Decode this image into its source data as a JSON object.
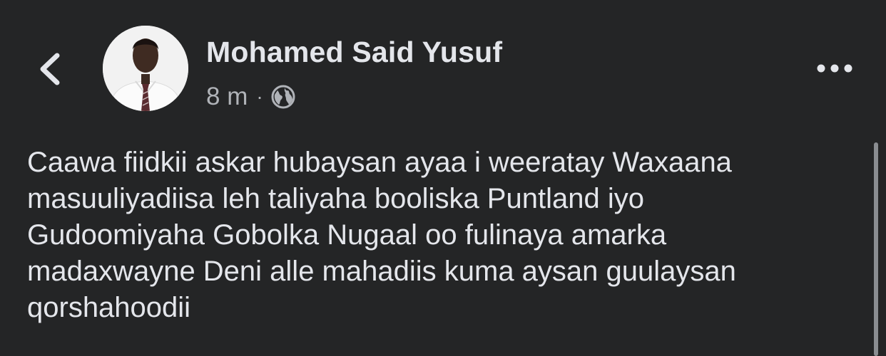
{
  "header": {
    "back_icon": "chevron-left-icon",
    "author_name": "Mohamed Said Yusuf",
    "timestamp": "8 m",
    "separator": "·",
    "privacy_icon": "globe-icon",
    "more_icon": "more-horizontal-icon"
  },
  "post": {
    "text": "Caawa fiidkii askar hubaysan ayaa i weeratay Waxaana\nmasuuliyadiisa  leh taliyaha booliska Puntland iyo\nGudoomiyaha Gobolka Nugaal oo fulinaya amarka\nmadaxwayne Deni alle mahadiis kuma aysan guulaysan\nqorshahoodii"
  },
  "colors": {
    "background": "#242526",
    "primary_text": "#e4e6eb",
    "secondary_text": "#b0b3b8"
  }
}
